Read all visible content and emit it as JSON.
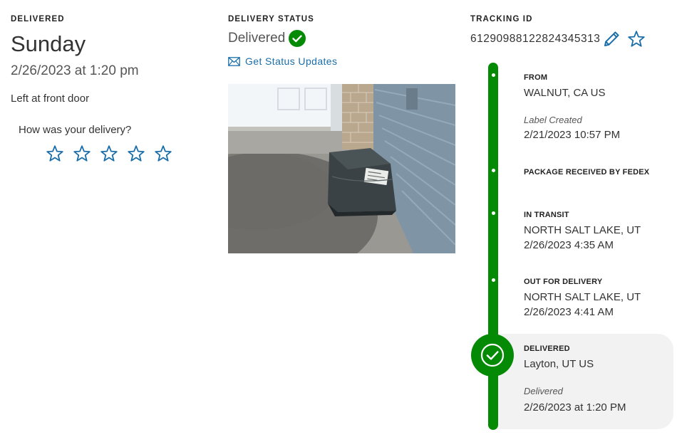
{
  "delivered_col": {
    "label": "DELIVERED",
    "day": "Sunday",
    "datetime": "2/26/2023 at 1:20 pm",
    "left_at": "Left at front door",
    "rating_question": "How was your delivery?",
    "rating_star_count": 5
  },
  "status_col": {
    "label": "DELIVERY STATUS",
    "status": "Delivered",
    "updates_link": "Get Status Updates",
    "photo_semantic": "delivery-photo"
  },
  "tracking_col": {
    "label": "TRACKING ID",
    "tracking_number": "612909881228243453​13"
  },
  "timeline": {
    "from": {
      "title": "FROM",
      "location": "WALNUT, CA US",
      "status": "Label Created",
      "datetime": "2/21/2023 10:57 PM"
    },
    "received": {
      "title": "PACKAGE RECEIVED BY FEDEX"
    },
    "in_transit": {
      "title": "IN TRANSIT",
      "location": "NORTH SALT LAKE, UT",
      "datetime": "2/26/2023 4:35 AM"
    },
    "out_for_delivery": {
      "title": "OUT FOR DELIVERY",
      "location": "NORTH SALT LAKE, UT",
      "datetime": "2/26/2023 4:41 AM"
    },
    "delivered": {
      "title": "DELIVERED",
      "location": "Layton, UT US",
      "status": "Delivered",
      "datetime": "2/26/2023 at 1:20 PM"
    }
  },
  "colors": {
    "accent_green": "#058a05",
    "link_blue": "#1a6ea9",
    "panel_gray": "#f2f2f2"
  },
  "icons": {
    "status_check": "check-circle-icon",
    "mail": "mail-icon",
    "edit": "pencil-icon",
    "favorite": "star-outline-icon",
    "rating": "star-outline-icon"
  }
}
